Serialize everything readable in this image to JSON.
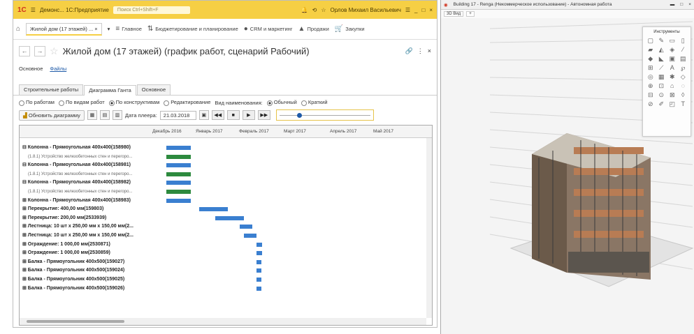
{
  "left_window": {
    "app_title": "Демонс... 1С:Предприятие",
    "search_placeholder": "Поиск Ctrl+Shift+F",
    "user": "Орлов Михаил Васильевич",
    "open_tab": "Жилой дом (17 этажей) ...",
    "nav": [
      "Главное",
      "Бюджетирование и планирование",
      "CRM и маркетинг",
      "Продажи",
      "Закупки"
    ],
    "form_title": "Жилой дом (17 этажей)  (график работ, сценарий Рабочий)",
    "sub_links": [
      "Основное",
      "Файлы"
    ],
    "tabs": [
      "Строительные работы",
      "Диаграмма Ганта",
      "Основное"
    ],
    "radios": [
      "По работам",
      "По видам работ",
      "По конструктивам",
      "Редактирование"
    ],
    "name_view_label": "Вид наименования:",
    "name_view_opts": [
      "Обычный",
      "Краткий"
    ],
    "refresh_btn": "Обновить диаграмму",
    "player_date_label": "Дата плеера:",
    "player_date": "21.03.2018",
    "slider_value": 0.2,
    "gantt_months": [
      "Декабрь 2016",
      "Январь 2017",
      "Февраль 2017",
      "Март 2017",
      "Апрель 2017",
      "Май 2017"
    ],
    "rows": [
      {
        "label": "⊟ Колонна - Прямоугольная 400х400(158980)",
        "bold": true,
        "start": 0.36,
        "len": 0.06,
        "green": false
      },
      {
        "label": "(1.8.1) Устройство железобетонных стен и перегоро...",
        "bold": false,
        "start": 0.36,
        "len": 0.06,
        "green": true
      },
      {
        "label": "⊟ Колонна - Прямоугольная 400х400(158981)",
        "bold": true,
        "start": 0.36,
        "len": 0.06,
        "green": false
      },
      {
        "label": "(1.8.1) Устройство железобетонных стен и перегоро...",
        "bold": false,
        "start": 0.36,
        "len": 0.06,
        "green": true
      },
      {
        "label": "⊟ Колонна - Прямоугольная 400х400(158982)",
        "bold": true,
        "start": 0.36,
        "len": 0.06,
        "green": false
      },
      {
        "label": "(1.8.1) Устройство железобетонных стен и перегоро...",
        "bold": false,
        "start": 0.36,
        "len": 0.06,
        "green": true
      },
      {
        "label": "⊞ Колонна - Прямоугольная 400х400(158983)",
        "bold": true,
        "start": 0.36,
        "len": 0.06,
        "green": false
      },
      {
        "label": "⊞ Перекрытие: 400,00 мм(159803)",
        "bold": true,
        "start": 0.44,
        "len": 0.07,
        "green": false
      },
      {
        "label": "⊞ Перекрытие: 200,00 мм(2533939)",
        "bold": true,
        "start": 0.48,
        "len": 0.07,
        "green": false
      },
      {
        "label": "⊞ Лестница: 10 шт х 250,00 мм х 150,00 мм(2...",
        "bold": true,
        "start": 0.54,
        "len": 0.03,
        "green": false
      },
      {
        "label": "⊞ Лестница: 10 шт х 250,00 мм х 150,00 мм(2...",
        "bold": true,
        "start": 0.55,
        "len": 0.03,
        "green": false
      },
      {
        "label": "⊞ Ограждение: 1 000,00 мм(2530871)",
        "bold": true,
        "start": 0.58,
        "len": 0.015,
        "green": false
      },
      {
        "label": "⊞ Ограждение: 1 000,00 мм(2530859)",
        "bold": true,
        "start": 0.58,
        "len": 0.015,
        "green": false
      },
      {
        "label": "⊞ Балка - Прямоугольник 400х500(159027)",
        "bold": true,
        "start": 0.58,
        "len": 0.012,
        "green": false
      },
      {
        "label": "⊞ Балка - Прямоугольник 400х500(159024)",
        "bold": true,
        "start": 0.58,
        "len": 0.012,
        "green": false
      },
      {
        "label": "⊞ Балка - Прямоугольник 400х500(159025)",
        "bold": true,
        "start": 0.58,
        "len": 0.012,
        "green": false
      },
      {
        "label": "⊞ Балка - Прямоугольник 400х500(159026)",
        "bold": true,
        "start": 0.58,
        "len": 0.012,
        "green": false
      }
    ]
  },
  "right_window": {
    "title": "Building 17 - Renga (Некоммерческое использование) - Автономная работа",
    "view_tab": "3D Вид",
    "tools_title": "Инструменты"
  }
}
